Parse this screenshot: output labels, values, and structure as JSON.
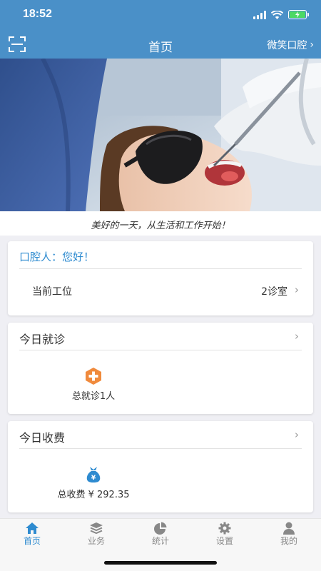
{
  "status_bar": {
    "time": "18:52"
  },
  "nav": {
    "title": "首页",
    "clinic": "微笑口腔"
  },
  "banner": {
    "caption": "美好的一天，从生活和工作开始！"
  },
  "greeting_card": {
    "greeting": "口腔人：您好！",
    "workstation_label": "当前工位",
    "workstation_value": "2诊室"
  },
  "visits_card": {
    "title": "今日就诊",
    "total_label": "总就诊1人",
    "icon": "plus-badge-icon"
  },
  "fees_card": {
    "title": "今日收费",
    "total_label": "总收费 ¥ 292.35",
    "icon": "money-bag-icon"
  },
  "tabs": [
    {
      "label": "首页",
      "icon": "home-icon",
      "active": true
    },
    {
      "label": "业务",
      "icon": "layers-icon",
      "active": false
    },
    {
      "label": "统计",
      "icon": "pie-chart-icon",
      "active": false
    },
    {
      "label": "设置",
      "icon": "gear-icon",
      "active": false
    },
    {
      "label": "我的",
      "icon": "person-icon",
      "active": false
    }
  ],
  "colors": {
    "primary": "#4a90c8",
    "accent": "#2e8bd0",
    "orange": "#f08a3c",
    "active_tab": "#2e8bd0"
  }
}
